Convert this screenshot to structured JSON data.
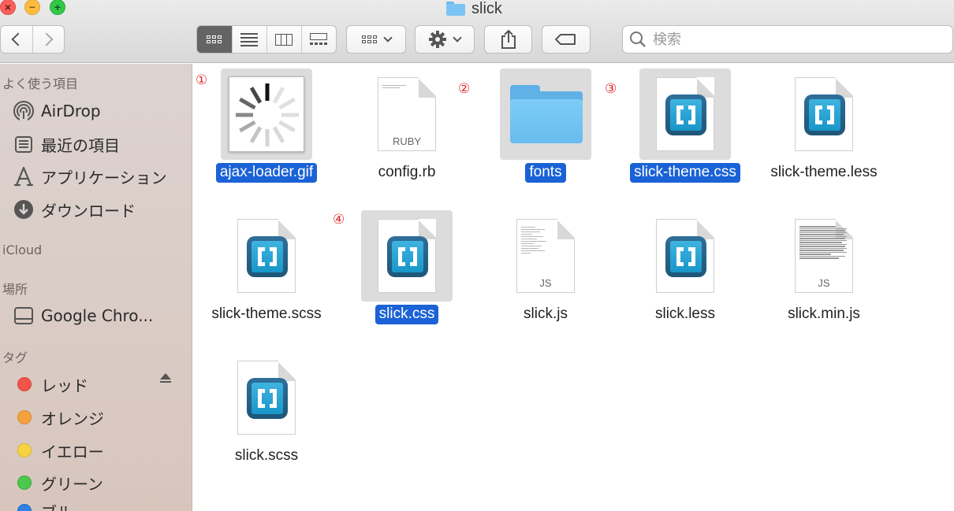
{
  "window": {
    "title": "slick",
    "close_glyph": "×",
    "min_glyph": "−",
    "max_glyph": "+"
  },
  "toolbar": {
    "search_placeholder": "検索",
    "back_icon": "chevron-left-icon",
    "forward_icon": "chevron-right-icon",
    "views": [
      "icon-view-icon",
      "list-view-icon",
      "column-view-icon",
      "gallery-view-icon"
    ],
    "active_view": "icon"
  },
  "sidebar": {
    "favorites_header": "よく使う項目",
    "favorites": [
      {
        "label": "AirDrop",
        "icon": "airdrop-icon"
      },
      {
        "label": "最近の項目",
        "icon": "recents-icon"
      },
      {
        "label": "アプリケーション",
        "icon": "applications-icon"
      },
      {
        "label": "ダウンロード",
        "icon": "downloads-icon"
      }
    ],
    "icloud_header": "iCloud",
    "places_header": "場所",
    "places": [
      {
        "label": "Google Chro...",
        "icon": "disk-icon"
      }
    ],
    "tags_header": "タグ",
    "tags": [
      {
        "label": "レッド",
        "color": "#f2534a"
      },
      {
        "label": "オレンジ",
        "color": "#f5a13d"
      },
      {
        "label": "イエロー",
        "color": "#f9d23f"
      },
      {
        "label": "グリーン",
        "color": "#4cc84e"
      },
      {
        "label": "ブルー",
        "color": "#2f7fe6"
      }
    ]
  },
  "files": [
    {
      "name": "ajax-loader.gif",
      "kind": "gif",
      "selected": true,
      "annotation": "①"
    },
    {
      "name": "config.rb",
      "kind": "ruby",
      "ext": "RUBY",
      "selected": false,
      "annotation": "②"
    },
    {
      "name": "fonts",
      "kind": "folder",
      "selected": true,
      "annotation": "③"
    },
    {
      "name": "slick-theme.css",
      "kind": "brackets",
      "selected": true
    },
    {
      "name": "slick-theme.less",
      "kind": "brackets",
      "selected": false
    },
    {
      "name": "slick-theme.scss",
      "kind": "brackets",
      "selected": false,
      "annotation": "④"
    },
    {
      "name": "slick.css",
      "kind": "brackets",
      "selected": true
    },
    {
      "name": "slick.js",
      "kind": "js",
      "ext": "JS",
      "selected": false
    },
    {
      "name": "slick.less",
      "kind": "brackets",
      "selected": false
    },
    {
      "name": "slick.min.js",
      "kind": "js-min",
      "ext": "JS",
      "selected": false
    },
    {
      "name": "slick.scss",
      "kind": "brackets",
      "selected": false
    }
  ]
}
